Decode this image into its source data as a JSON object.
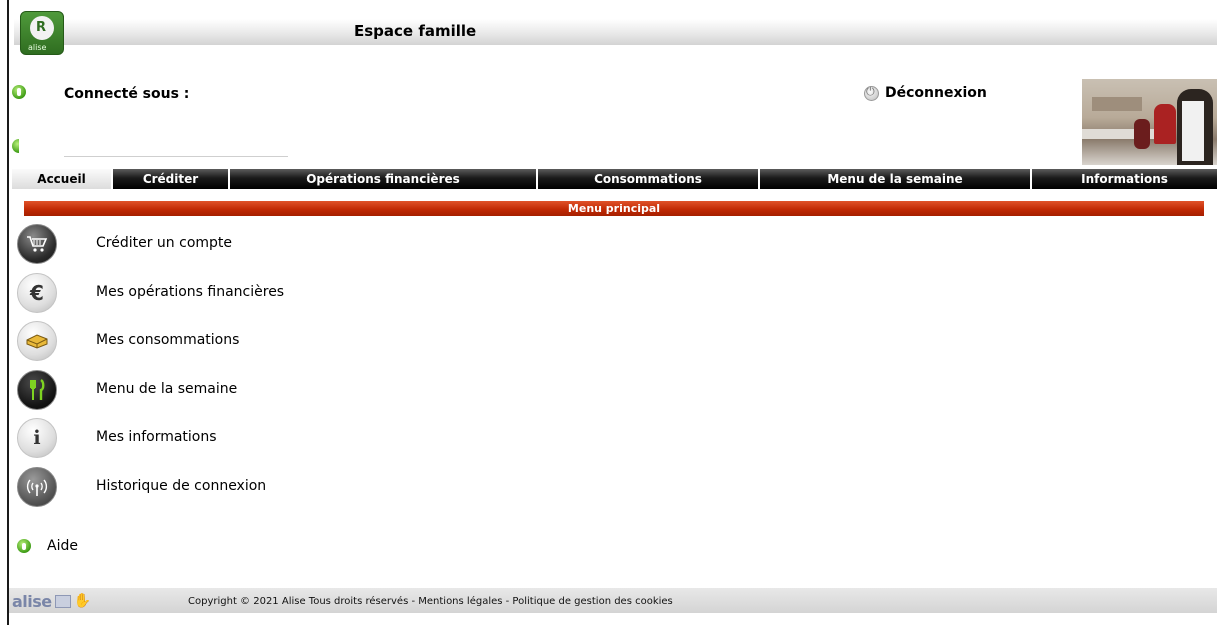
{
  "header": {
    "title": "Espace famille",
    "logo_alt": "alise",
    "logo_letter": "R"
  },
  "session": {
    "connected_label": "Connecté sous :",
    "username": "",
    "logout_label": "Déconnexion"
  },
  "nav": {
    "items": [
      {
        "label": "Accueil",
        "active": true
      },
      {
        "label": "Créditer",
        "active": false
      },
      {
        "label": "Opérations financières",
        "active": false
      },
      {
        "label": "Consommations",
        "active": false
      },
      {
        "label": "Menu de la semaine",
        "active": false
      },
      {
        "label": "Informations",
        "active": false
      }
    ]
  },
  "section": {
    "title": "Menu principal",
    "color": "#c22a05"
  },
  "menu": {
    "items": [
      {
        "label": "Créditer un compte",
        "icon": "shopping-cart-icon"
      },
      {
        "label": "Mes opérations financières",
        "icon": "euro-icon"
      },
      {
        "label": "Mes consommations",
        "icon": "food-icon"
      },
      {
        "label": "Menu de la semaine",
        "icon": "fork-knife-icon"
      },
      {
        "label": "Mes informations",
        "icon": "info-icon"
      },
      {
        "label": "Historique de connexion",
        "icon": "signal-icon"
      }
    ]
  },
  "help": {
    "label": "Aide"
  },
  "footer": {
    "logo_text": "alise",
    "copyright": "Copyright © 2021 Alise Tous droits réservés - Mentions légales - Politique de gestion des cookies"
  },
  "colors": {
    "nav_background": "#000000",
    "accent_red": "#c22a05",
    "status_green": "#3f9d16"
  }
}
